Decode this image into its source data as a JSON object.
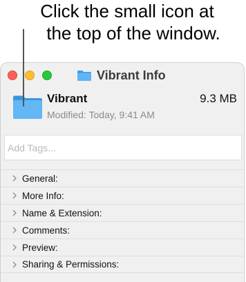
{
  "callout": {
    "line1": "Click the small icon at",
    "line2": "the top of the window."
  },
  "window": {
    "title": "Vibrant Info",
    "traffic_lights": [
      "close",
      "minimize",
      "zoom"
    ],
    "folder_color": "#5aaef0"
  },
  "file": {
    "name": "Vibrant",
    "size": "9.3 MB",
    "modified": "Modified: Today, 9:41 AM"
  },
  "tags": {
    "placeholder": "Add Tags..."
  },
  "sections": [
    {
      "label": "General:"
    },
    {
      "label": "More Info:"
    },
    {
      "label": "Name & Extension:"
    },
    {
      "label": "Comments:"
    },
    {
      "label": "Preview:"
    },
    {
      "label": "Sharing & Permissions:"
    }
  ]
}
